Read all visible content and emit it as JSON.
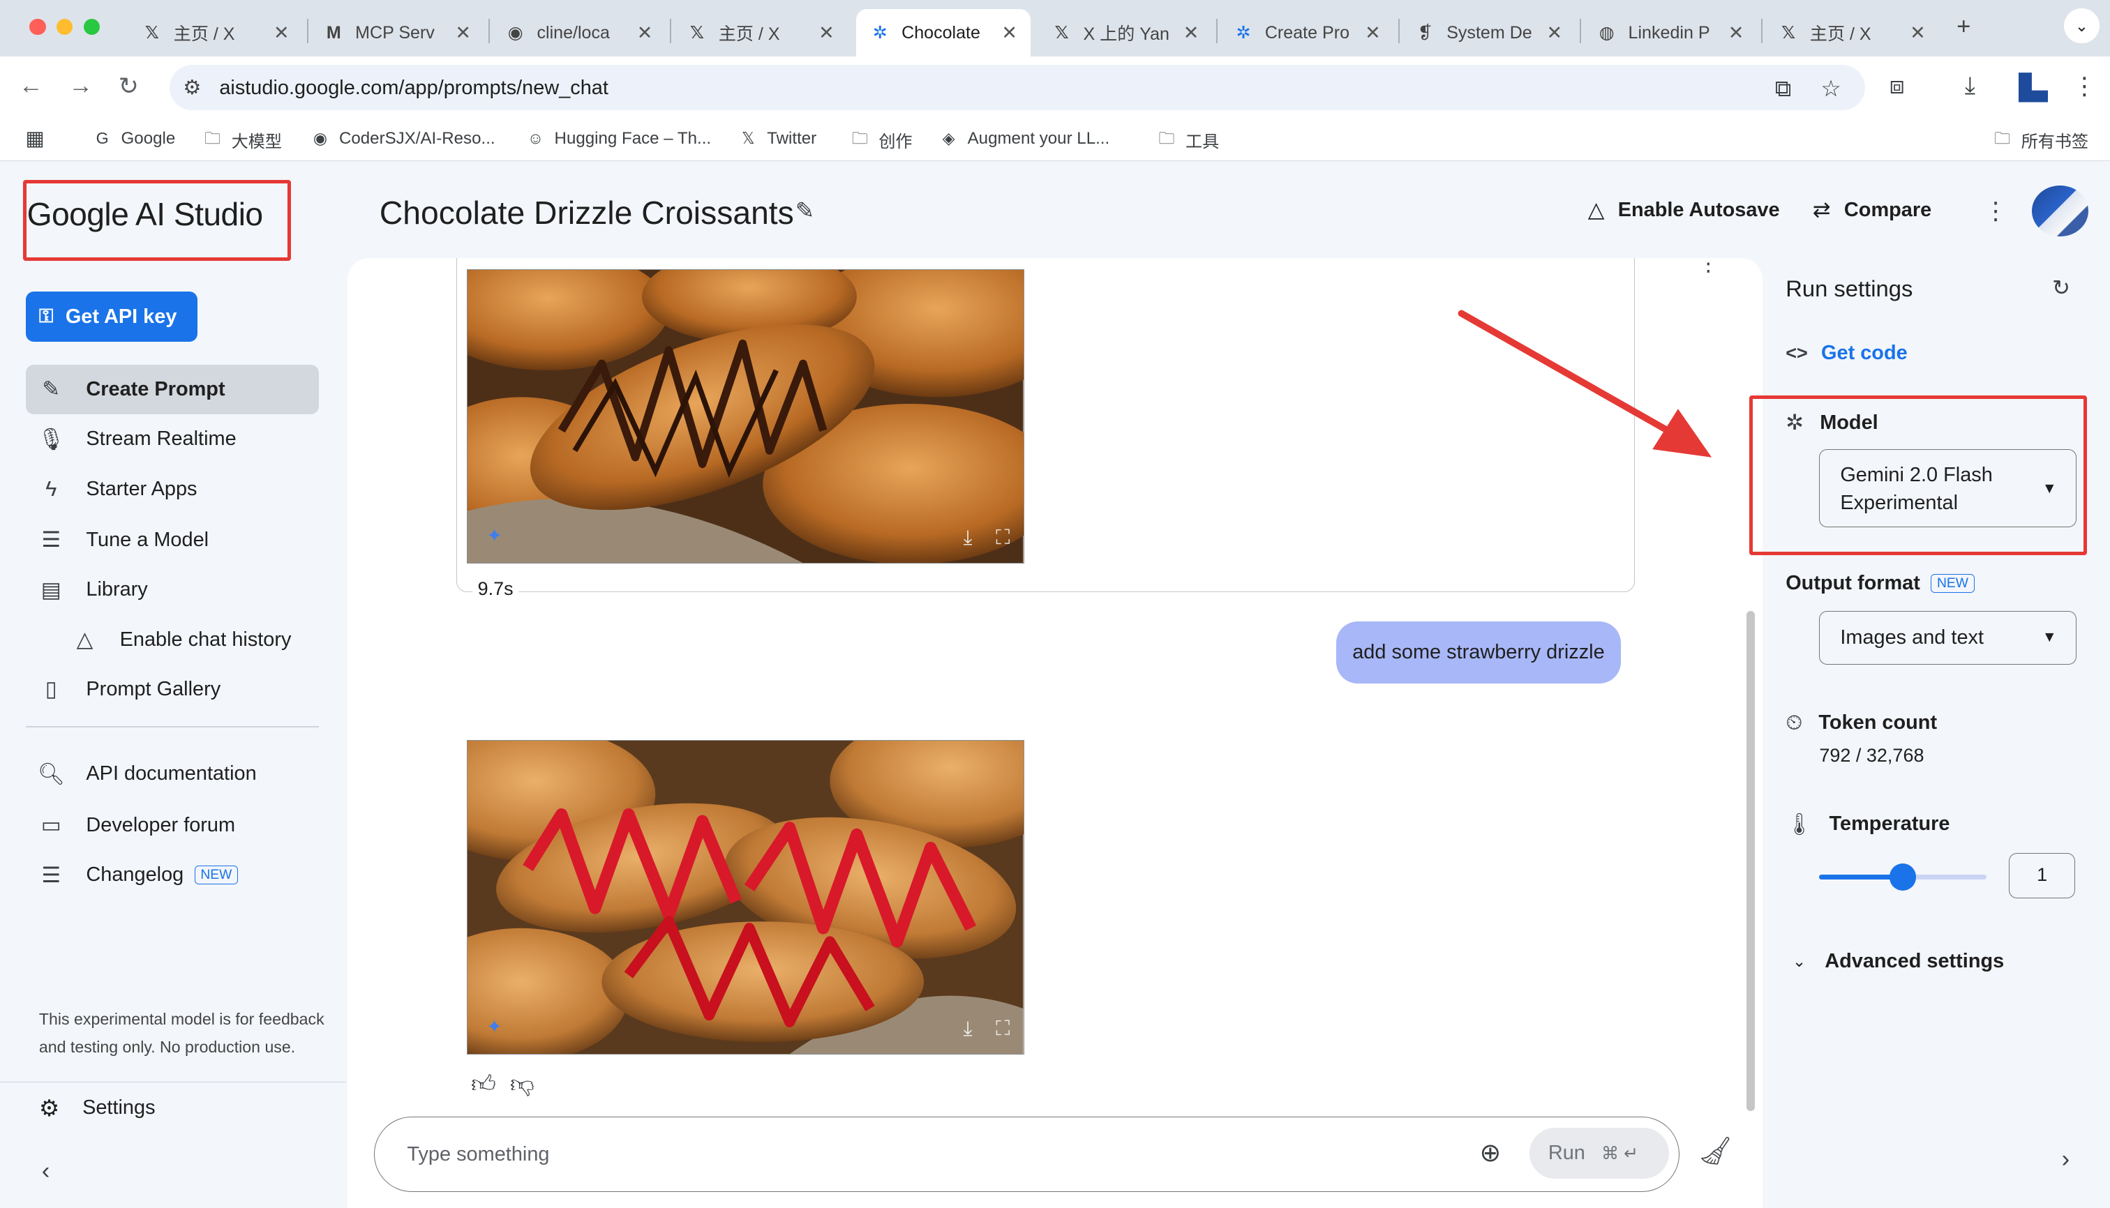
{
  "browser": {
    "tabs": [
      {
        "title": "主页 / X",
        "icon": "x-logo-icon"
      },
      {
        "title": "MCP Serv",
        "icon": "medium-logo-icon"
      },
      {
        "title": "cline/loca",
        "icon": "github-logo-icon"
      },
      {
        "title": "主页 / X",
        "icon": "x-logo-icon"
      },
      {
        "title": "Chocolate",
        "icon": "ai-studio-icon",
        "active": true
      },
      {
        "title": "X 上的 Yan",
        "icon": "x-logo-icon"
      },
      {
        "title": "Create Pro",
        "icon": "ai-studio-icon"
      },
      {
        "title": "System De",
        "icon": "document-icon"
      },
      {
        "title": "Linkedin P",
        "icon": "globe-icon"
      },
      {
        "title": "主页 / X",
        "icon": "x-logo-icon"
      }
    ],
    "url": "aistudio.google.com/app/prompts/new_chat",
    "bookmarks": [
      {
        "label": "Google",
        "icon": "google-icon"
      },
      {
        "label": "大模型",
        "icon": "folder-icon"
      },
      {
        "label": "CoderSJX/AI-Reso...",
        "icon": "github-logo-icon"
      },
      {
        "label": "Hugging Face – Th...",
        "icon": "hugging-face-icon"
      },
      {
        "label": "Twitter",
        "icon": "x-logo-icon"
      },
      {
        "label": "创作",
        "icon": "folder-icon"
      },
      {
        "label": "Augment your LL...",
        "icon": "layers-icon"
      },
      {
        "label": "工具",
        "icon": "folder-icon"
      }
    ],
    "all_bookmarks": "所有书签"
  },
  "sidebar": {
    "logo": "Google AI Studio",
    "api_key_button": "Get API key",
    "nav": [
      {
        "label": "Create Prompt",
        "icon": "create-prompt-icon",
        "selected": true
      },
      {
        "label": "Stream Realtime",
        "icon": "microphone-icon"
      },
      {
        "label": "Starter Apps",
        "icon": "bolt-icon"
      },
      {
        "label": "Tune a Model",
        "icon": "tune-icon"
      },
      {
        "label": "Library",
        "icon": "library-icon"
      },
      {
        "label": "Enable chat history",
        "icon": "drive-icon"
      },
      {
        "label": "Prompt Gallery",
        "icon": "book-icon"
      }
    ],
    "links": [
      {
        "label": "API documentation",
        "icon": "docs-search-icon"
      },
      {
        "label": "Developer forum",
        "icon": "forum-icon"
      },
      {
        "label": "Changelog",
        "icon": "changelog-icon",
        "badge": "NEW"
      }
    ],
    "footnote": "This experimental model is for feedback and testing only. No production use.",
    "settings": "Settings"
  },
  "header": {
    "title": "Chocolate Drizzle Croissants",
    "autosave": "Enable Autosave",
    "compare": "Compare"
  },
  "chat": {
    "response_time": "9.7s",
    "user_message": "add some strawberry drizzle",
    "input_placeholder": "Type something",
    "run_label": "Run",
    "run_shortcut": "⌘ ↵"
  },
  "run_settings": {
    "title": "Run settings",
    "get_code": "Get code",
    "model_label": "Model",
    "model_value_line1": "Gemini 2.0 Flash",
    "model_value_line2": "Experimental",
    "output_format_label": "Output format",
    "output_format_badge": "NEW",
    "output_format_value": "Images and text",
    "token_count_label": "Token count",
    "token_count_value": "792 / 32,768",
    "temperature_label": "Temperature",
    "temperature_value": "1",
    "temperature_fraction": 0.5,
    "advanced_label": "Advanced settings"
  },
  "colors": {
    "accent": "#1a73e8",
    "highlight_box": "#e53935",
    "user_bubble": "#a8b7f7",
    "chocolate": "#4a2511",
    "strawberry": "#d8192a"
  }
}
